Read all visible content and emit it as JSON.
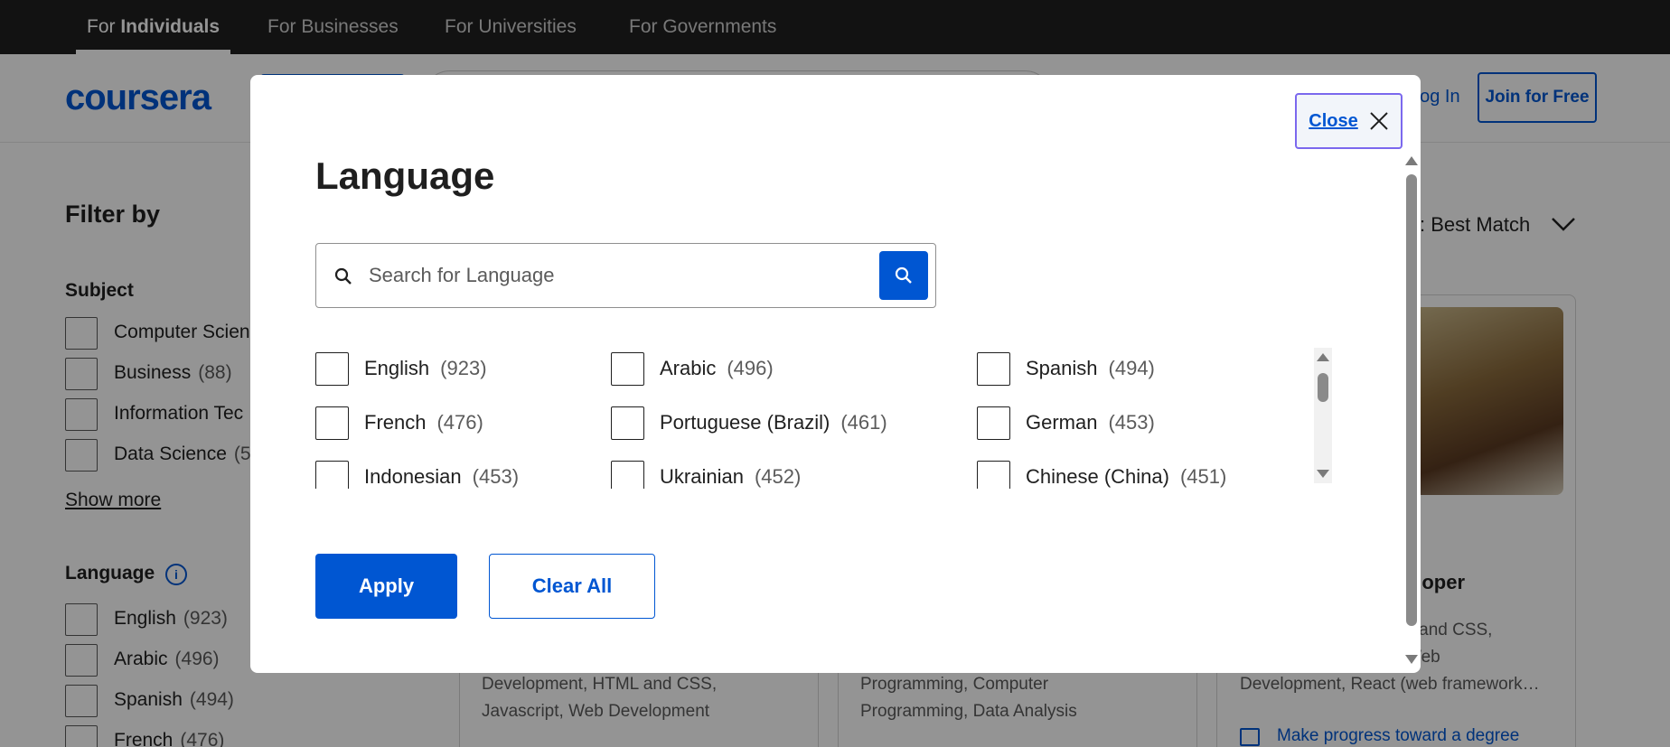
{
  "topbar": {
    "tabs": [
      {
        "prefix": "For ",
        "bold": "Individuals"
      },
      {
        "label": "For Businesses"
      },
      {
        "label": "For Universities"
      },
      {
        "label": "For Governments"
      }
    ]
  },
  "header": {
    "logo": "coursera",
    "login": "Log In",
    "join": "Join for Free"
  },
  "filters": {
    "title": "Filter by",
    "subject": {
      "title": "Subject",
      "items": [
        {
          "label": "Computer Scien",
          "count": ""
        },
        {
          "label": "Business",
          "count": "(88)"
        },
        {
          "label": "Information Tec",
          "count": ""
        },
        {
          "label": "Data Science",
          "count": "(5"
        }
      ]
    },
    "show_more": "Show more",
    "language": {
      "title": "Language",
      "info_icon": "i",
      "items": [
        {
          "label": "English",
          "count": "(923)"
        },
        {
          "label": "Arabic",
          "count": "(496)"
        },
        {
          "label": "Spanish",
          "count": "(494)"
        },
        {
          "label": "French",
          "count": "(476)"
        }
      ]
    }
  },
  "sort": {
    "label": "y: Best Match"
  },
  "cards": [
    {
      "skills_lines": [
        "Development, HTML and CSS,",
        "Javascript, Web Development"
      ]
    },
    {
      "skills_lines": [
        "Programming, Computer",
        "Programming, Data Analysis"
      ]
    },
    {
      "title_fragment": "eloper",
      "skills_lines": [
        "L and CSS,",
        "Web",
        "Development, React (web framework…"
      ],
      "link": "Make progress toward a degree"
    }
  ],
  "modal": {
    "close_label": "Close",
    "title": "Language",
    "search_placeholder": "Search for Language",
    "options": [
      {
        "name": "English",
        "count": "(923)"
      },
      {
        "name": "Arabic",
        "count": "(496)"
      },
      {
        "name": "Spanish",
        "count": "(494)"
      },
      {
        "name": "French",
        "count": "(476)"
      },
      {
        "name": "Portuguese (Brazil)",
        "count": "(461)"
      },
      {
        "name": "German",
        "count": "(453)"
      },
      {
        "name": "Indonesian",
        "count": "(453)"
      },
      {
        "name": "Ukrainian",
        "count": "(452)"
      },
      {
        "name": "Chinese (China)",
        "count": "(451)"
      }
    ],
    "apply_label": "Apply",
    "clear_label": "Clear All"
  },
  "colors": {
    "brand": "#0056d2",
    "topbar": "#1f1f1f",
    "overlay": "rgba(0,0,0,0.42)",
    "focus_ring": "#7b68ee"
  },
  "icons": [
    "search-icon",
    "close-icon",
    "info-icon",
    "chevron-down-icon",
    "scroll-up-arrow",
    "scroll-down-arrow"
  ]
}
